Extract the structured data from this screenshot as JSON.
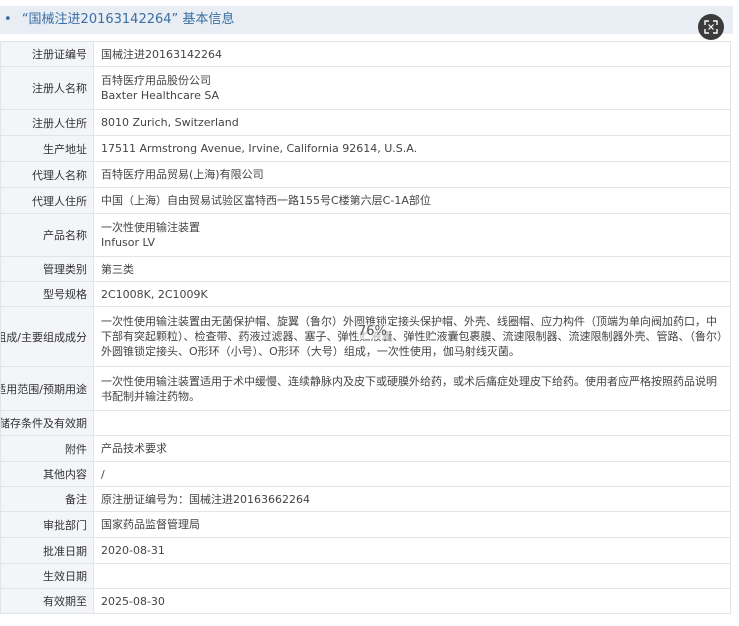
{
  "header": {
    "bullet": "•",
    "title": "“国械注进20163142264” 基本信息"
  },
  "zoom": "76%",
  "rows": [
    {
      "label": "注册证编号",
      "lines": [
        "国械注进20163142264"
      ]
    },
    {
      "label": "注册人名称",
      "lines": [
        "百特医疗用品股份公司",
        "Baxter Healthcare SA"
      ]
    },
    {
      "label": "注册人住所",
      "lines": [
        "8010 Zurich, Switzerland"
      ]
    },
    {
      "label": "生产地址",
      "lines": [
        "17511 Armstrong Avenue, Irvine, California 92614, U.S.A."
      ]
    },
    {
      "label": "代理人名称",
      "lines": [
        "百特医疗用品贸易(上海)有限公司"
      ]
    },
    {
      "label": "代理人住所",
      "lines": [
        "中国（上海）自由贸易试验区富特西一路155号C楼第六层C-1A部位"
      ]
    },
    {
      "label": "产品名称",
      "lines": [
        "一次性使用输注装置",
        "Infusor LV"
      ]
    },
    {
      "label": "管理类别",
      "lines": [
        "第三类"
      ]
    },
    {
      "label": "型号规格",
      "lines": [
        "2C1008K, 2C1009K"
      ]
    },
    {
      "label": "结构及组成/主要组成成分",
      "lines": [
        "一次性使用输注装置由无菌保护帽、旋翼（鲁尔）外圆锥锁定接头保护帽、外壳、线圈帽、应力构件（顶端为单向阀加药口，中下部有突起颗粒）、检查带、药液过滤器、塞子、弹性贮液囊、弹性贮液囊包裹膜、流速限制器、流速限制器外壳、管路、（鲁尔）外圆锥锁定接头、O形环（小号）、O形环（大号）组成，一次性使用，伽马射线灭菌。"
      ]
    },
    {
      "label": "适用范围/预期用途",
      "lines": [
        "一次性使用输注装置适用于术中缓慢、连续静脉内及皮下或硬膜外给药，或术后痛症处理皮下给药。使用者应严格按照药品说明书配制并输注药物。"
      ]
    },
    {
      "label": "产品储存条件及有效期",
      "lines": [
        ""
      ]
    },
    {
      "label": "附件",
      "lines": [
        "产品技术要求"
      ]
    },
    {
      "label": "其他内容",
      "lines": [
        "/"
      ]
    },
    {
      "label": "备注",
      "lines": [
        "原注册证编号为：国械注进20163662264"
      ]
    },
    {
      "label": "审批部门",
      "lines": [
        "国家药品监督管理局"
      ]
    },
    {
      "label": "批准日期",
      "lines": [
        "2020-08-31"
      ]
    },
    {
      "label": "生效日期",
      "lines": [
        ""
      ]
    },
    {
      "label": "有效期至",
      "lines": [
        "2025-08-30"
      ]
    }
  ]
}
